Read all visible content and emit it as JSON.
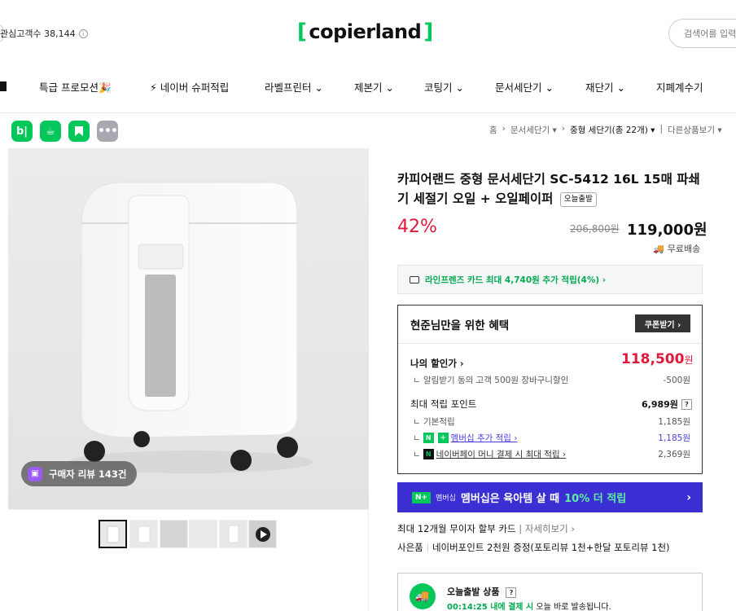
{
  "header": {
    "interest_count": "관심고객수 38,144",
    "logo_bracket_open": "[",
    "logo_text": "copierland",
    "logo_bracket_close": "]",
    "search_placeholder": "검색어를 입력"
  },
  "nav": {
    "items": [
      {
        "label": "특급 프로모션🎉"
      },
      {
        "label": "⚡ 네이버 슈퍼적립"
      },
      {
        "label": "라벨프린터 ⌄"
      },
      {
        "label": "제본기 ⌄"
      },
      {
        "label": "코팅기 ⌄"
      },
      {
        "label": "문서세단기 ⌄"
      },
      {
        "label": "재단기 ⌄"
      },
      {
        "label": "지폐계수기"
      }
    ]
  },
  "share_icons": [
    "blog-icon",
    "cafe-icon",
    "bookmark-icon",
    "more-icon"
  ],
  "breadcrumb": {
    "home": "홈",
    "cat": "문서세단기 ▾",
    "current": "중형 세단기(총 22개) ▾",
    "other": "다른상품보기 ▾"
  },
  "gallery": {
    "review_badge": "구매자 리뷰 143건",
    "thumb_count": 6
  },
  "product": {
    "title": "카피어랜드 중형 문서세단기 SC-5412 16L 15매 파쇄기 세절기 오일 + 오일페이퍼",
    "tag": "오늘출발",
    "discount": "42%",
    "original_price": "206,800원",
    "price": "119,000원",
    "shipping": "무료배송",
    "card_promo": "라인프렌즈 카드 최대 4,740원 추가 적립(4%) ›"
  },
  "benefit": {
    "title": "현준님만을 위한 혜택",
    "coupon_button": "쿠폰받기 ›",
    "my_discount_label": "나의 할인가 ›",
    "my_discount_value": "118,500",
    "my_discount_unit": "원",
    "alarm_label": "알림받기 동의 고객 500원 장바구니할인",
    "alarm_value": "-500원",
    "max_point_label": "최대 적립 포인트",
    "max_point_value": "6,989원",
    "basic_label": "기본적립",
    "basic_value": "1,185원",
    "member_label": "멤버십 추가 적립 ›",
    "member_value": "1,185원",
    "npay_label": "네이버페이 머니 결제 시 최대 적립 ›",
    "npay_value": "2,369원"
  },
  "banner": {
    "badge": "N+",
    "sub": "멤버십",
    "text_a": "멤버십은 육아템 살 때",
    "text_b": "10% 더 적립",
    "arrow": "›"
  },
  "info": {
    "installment": "최대 12개월 무이자 할부 카드",
    "installment_link": "자세히보기 ›",
    "gift_label": "사은품",
    "gift_value": "네이버포인트 2천원 증정(포토리뷰 1천+한달 포토리뷰 1천)"
  },
  "delivery": {
    "title": "오늘출발 상품",
    "time": "00:14:25 내에 결제 시",
    "desc": "오늘 바로 발송됩니다."
  },
  "colors": {
    "brand_green": "#03c75a",
    "sale_red": "#e0193b",
    "banner_purple": "#3b2fd3"
  }
}
